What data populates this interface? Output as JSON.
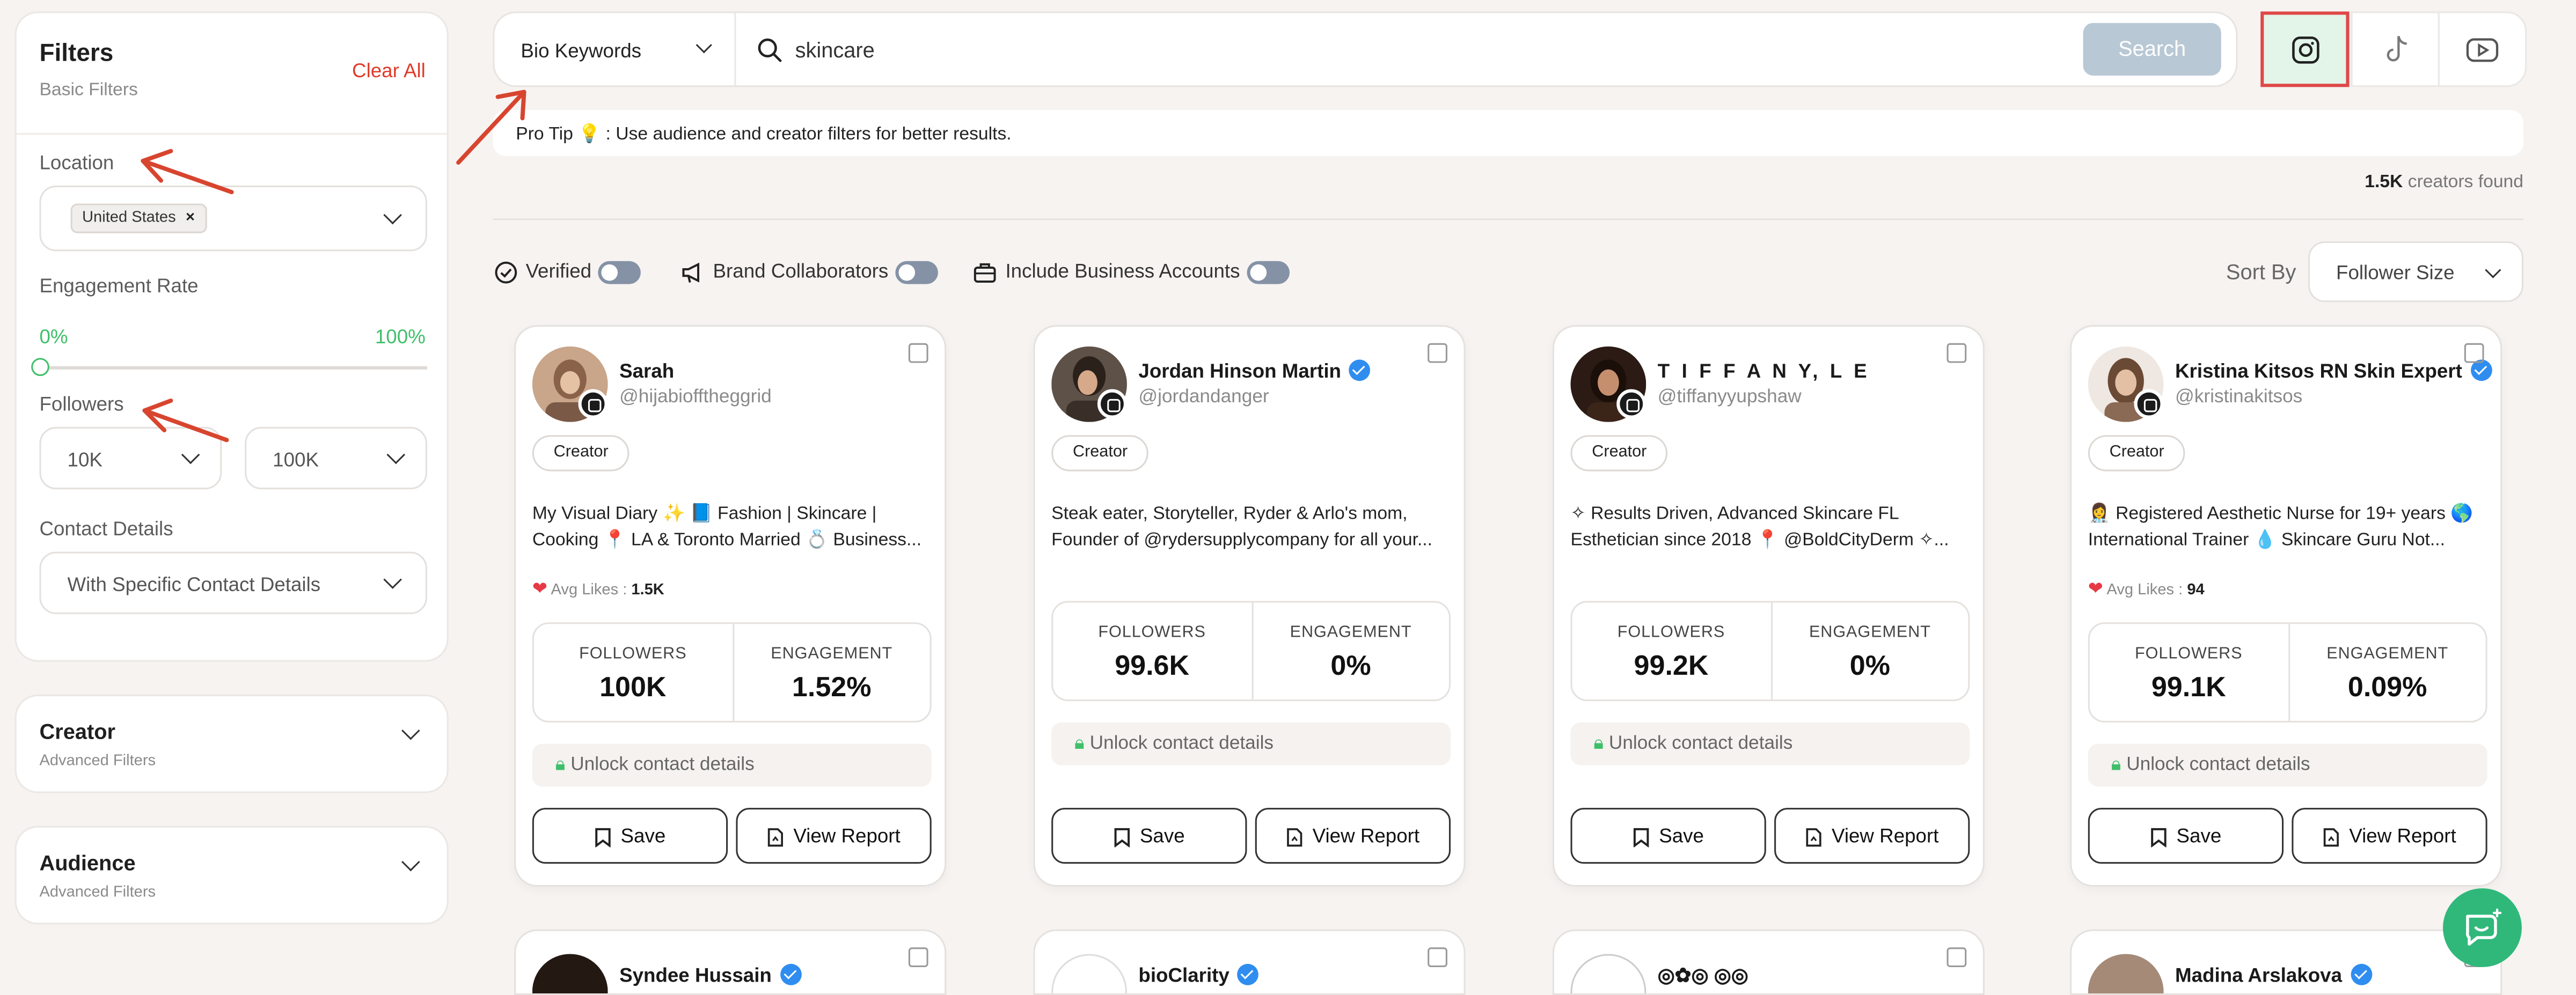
{
  "sidebar": {
    "title": "Filters",
    "subtitle": "Basic Filters",
    "clear_all": "Clear All",
    "location": {
      "label": "Location",
      "chip": "United States",
      "chip_remove": "×"
    },
    "engagement": {
      "label": "Engagement Rate",
      "min": "0%",
      "max": "100%"
    },
    "followers": {
      "label": "Followers",
      "min": "10K",
      "max": "100K"
    },
    "contact": {
      "label": "Contact Details",
      "value": "With Specific Contact Details"
    },
    "creator": {
      "title": "Creator",
      "subtitle": "Advanced Filters"
    },
    "audience": {
      "title": "Audience",
      "subtitle": "Advanced Filters"
    }
  },
  "search": {
    "type": "Bio Keywords",
    "query": "skincare",
    "button": "Search"
  },
  "platforms": [
    "instagram-icon",
    "tiktok-icon",
    "youtube-icon"
  ],
  "tip": "Pro Tip 💡 :  Use audience and creator filters for better results.",
  "results": {
    "count": "1.5K",
    "suffix": " creators found"
  },
  "toggles": {
    "verified": "Verified",
    "brand": "Brand Collaborators",
    "business": "Include Business Accounts"
  },
  "sort": {
    "label": "Sort By",
    "value": "Follower Size"
  },
  "cards": [
    {
      "name": "Sarah",
      "handle": "@hijabiofftheggrid",
      "role": "Creator",
      "bio1": "My Visual Diary ✨ 📘 Fashion | Skincare |",
      "bio2": "Cooking 📍 LA & Toronto Married 💍  Business...",
      "likes_label": "Avg Likes : ",
      "likes": "1.5K",
      "followers_label": "FOLLOWERS",
      "followers": "100K",
      "engagement_label": "ENGAGEMENT",
      "engagement": "1.52%",
      "unlock": "Unlock contact details",
      "save": "Save",
      "report": "View Report"
    },
    {
      "name": "Jordan Hinson Martin",
      "handle": "@jordandanger",
      "role": "Creator",
      "bio1": "Steak eater, Storyteller, Ryder & Arlo's mom,",
      "bio2": "Founder of @rydersupplycompany for all your...",
      "followers_label": "FOLLOWERS",
      "followers": "99.6K",
      "engagement_label": "ENGAGEMENT",
      "engagement": "0%",
      "unlock": "Unlock contact details",
      "save": "Save",
      "report": "View Report"
    },
    {
      "name": "T I F F A N Y,  L E",
      "handle": "@tiffanyyupshaw",
      "role": "Creator",
      "bio1": "✧ Results Driven, Advanced Skincare FL",
      "bio2": "Esthetician since 2018 📍 @BoldCityDerm ✧...",
      "followers_label": "FOLLOWERS",
      "followers": "99.2K",
      "engagement_label": "ENGAGEMENT",
      "engagement": "0%",
      "unlock": "Unlock contact details",
      "save": "Save",
      "report": "View Report"
    },
    {
      "name": "Kristina Kitsos RN Skin Expert",
      "handle": "@kristinakitsos",
      "role": "Creator",
      "bio1": "👩‍⚕️ Registered Aesthetic Nurse for 19+ years 🌎",
      "bio2": "International Trainer 💧 Skincare Guru Not...",
      "likes_label": "Avg Likes : ",
      "likes": "94",
      "followers_label": "FOLLOWERS",
      "followers": "99.1K",
      "engagement_label": "ENGAGEMENT",
      "engagement": "0.09%",
      "unlock": "Unlock contact details",
      "save": "Save",
      "report": "View Report"
    }
  ],
  "next_row": [
    {
      "name": "Syndee Hussain"
    },
    {
      "name": "bioClarity"
    },
    {
      "name": "◎✿◎ ◎◎"
    },
    {
      "name": "Madina Arslakova"
    }
  ],
  "colors": {
    "accent_green": "#3fbf6a",
    "alert_red": "#e03b2a",
    "verified_blue": "#2f8df0",
    "chat_green": "#2fb87a"
  }
}
